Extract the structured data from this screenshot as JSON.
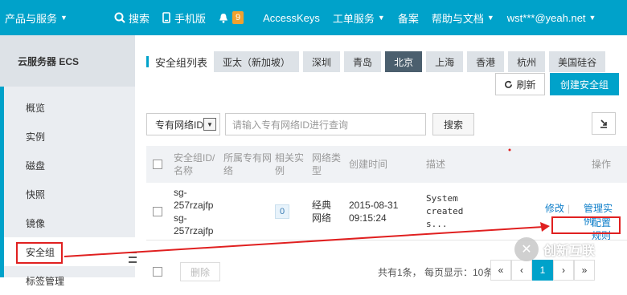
{
  "topbar": {
    "brand": "产品与服务",
    "search": "搜索",
    "mobile": "手机版",
    "bell_count": "9",
    "access_keys": "AccessKeys",
    "ticket": "工单服务",
    "beian": "备案",
    "help": "帮助与文档",
    "user": "wst***@yeah.net"
  },
  "sidebar": {
    "title": "云服务器 ECS",
    "items": [
      {
        "label": "概览"
      },
      {
        "label": "实例"
      },
      {
        "label": "磁盘"
      },
      {
        "label": "快照"
      },
      {
        "label": "镜像"
      },
      {
        "label": "安全组"
      },
      {
        "label": "标签管理"
      }
    ]
  },
  "main": {
    "title": "安全组列表",
    "regions": [
      "亚太（新加坡）",
      "深圳",
      "青岛",
      "北京",
      "上海",
      "香港",
      "杭州",
      "美国硅谷"
    ],
    "active_region": "北京",
    "refresh_label": "刷新",
    "create_label": "创建安全组",
    "filter_select": "专有网络ID",
    "search_placeholder": "请输入专有网络ID进行查询",
    "search_button": "搜索",
    "columns": [
      "安全组ID/名称",
      "所属专有网络",
      "相关实例",
      "网络类型",
      "创建时间",
      "描述",
      "操作"
    ],
    "rows": [
      {
        "id": "sg-257rzajfp",
        "name": "sg-257rzajfp",
        "vpc": "",
        "instances": "0",
        "net_type": "经典网络",
        "created": "2015-08-31 09:15:24",
        "desc": "System created s...",
        "actions": [
          "修改",
          "管理实例",
          "配置规则"
        ]
      }
    ],
    "delete_label": "删除",
    "summary": "共有1条， 每页显示：10条",
    "pager": [
      "«",
      "‹",
      "1",
      "›",
      "»"
    ]
  },
  "watermark": {
    "text": "创新互联"
  },
  "colors": {
    "accent": "#00a2ca",
    "highlight": "#e02020"
  }
}
